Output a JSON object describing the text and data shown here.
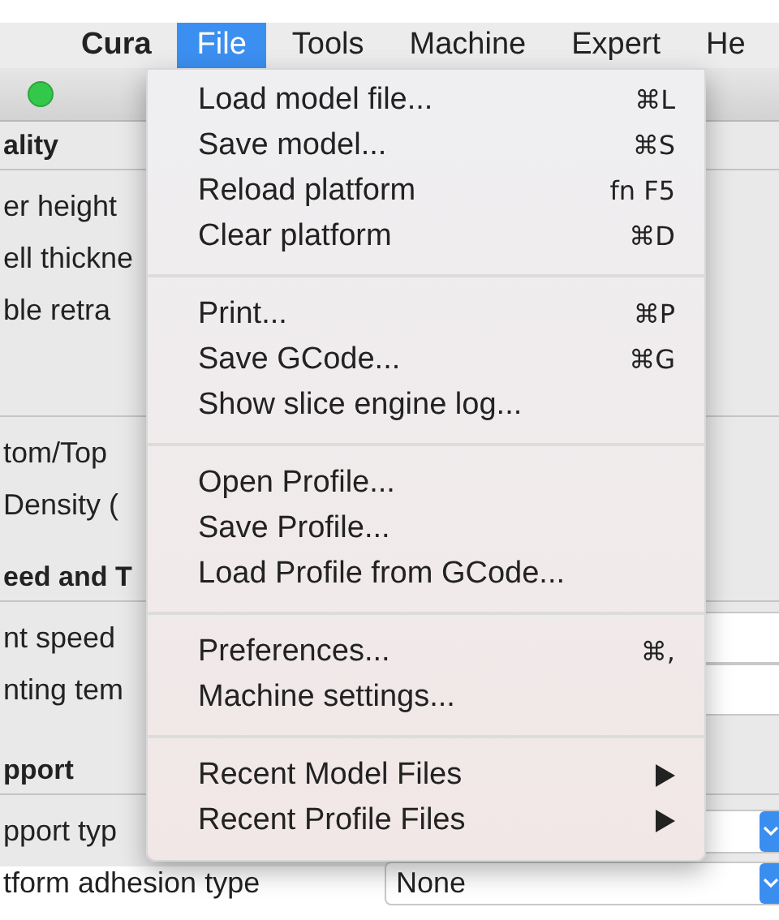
{
  "menu_bar": {
    "items": [
      {
        "label": "Cura",
        "kind": "app",
        "selected": false
      },
      {
        "label": "File",
        "kind": "menu",
        "selected": true
      },
      {
        "label": "Tools",
        "kind": "menu",
        "selected": false
      },
      {
        "label": "Machine",
        "kind": "menu",
        "selected": false
      },
      {
        "label": "Expert",
        "kind": "menu",
        "selected": false
      },
      {
        "label": "He",
        "kind": "menu",
        "selected": false
      }
    ]
  },
  "settings_panel": {
    "sections": [
      {
        "title": "ality",
        "rows": [
          {
            "label": "er height",
            "kind": "plain"
          },
          {
            "label": "ell thickne",
            "kind": "plain"
          },
          {
            "label": "ble retra",
            "kind": "plain"
          }
        ]
      },
      {
        "rows": [
          {
            "label": "tom/Top",
            "kind": "plain"
          },
          {
            "label": "Density (",
            "kind": "plain"
          }
        ]
      },
      {
        "title": "eed and T",
        "rows": [
          {
            "label": "nt speed",
            "kind": "field"
          },
          {
            "label": "nting tem",
            "kind": "field"
          }
        ]
      },
      {
        "title": "pport",
        "rows": [
          {
            "label": "pport typ",
            "kind": "select"
          },
          {
            "label": "tform adhesion type",
            "kind": "select",
            "value": "None"
          }
        ]
      }
    ]
  },
  "file_menu": {
    "groups": [
      [
        {
          "label": "Load model file...",
          "shortcut": "⌘L"
        },
        {
          "label": "Save model...",
          "shortcut": "⌘S"
        },
        {
          "label": "Reload platform",
          "shortcut": "fn F5"
        },
        {
          "label": "Clear platform",
          "shortcut": "⌘D"
        }
      ],
      [
        {
          "label": "Print...",
          "shortcut": "⌘P"
        },
        {
          "label": "Save GCode...",
          "shortcut": "⌘G"
        },
        {
          "label": "Show slice engine log..."
        }
      ],
      [
        {
          "label": "Open Profile..."
        },
        {
          "label": "Save Profile..."
        },
        {
          "label": "Load Profile from GCode..."
        }
      ],
      [
        {
          "label": "Preferences...",
          "shortcut": "⌘,"
        },
        {
          "label": "Machine settings..."
        }
      ],
      [
        {
          "label": "Recent Model Files",
          "submenu": true
        },
        {
          "label": "Recent Profile Files",
          "submenu": true
        }
      ]
    ]
  }
}
